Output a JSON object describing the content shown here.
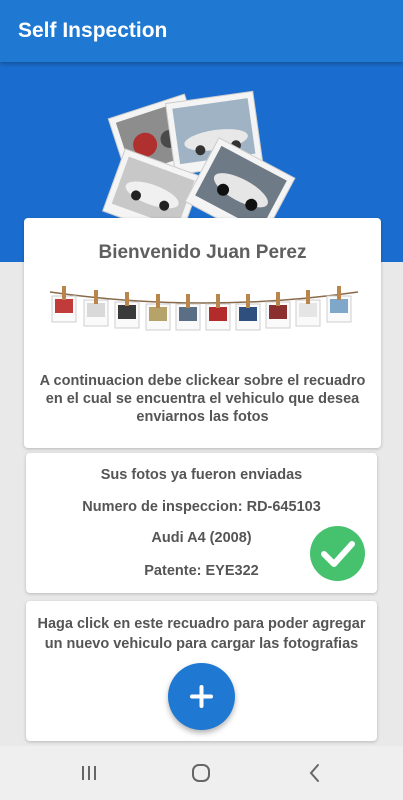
{
  "appbar": {
    "title": "Self Inspection"
  },
  "welcome": {
    "title": "Bienvenido Juan Perez",
    "instructions": "A continuacion debe clickear sobre el recuadro en el cual se encuentra el vehiculo que desea enviarnos las fotos"
  },
  "sent_card": {
    "status": "Sus fotos ya fueron enviadas",
    "inspection_number": "Numero de inspeccion: RD-645103",
    "vehicle": "Audi A4  (2008)",
    "plate": "Patente: EYE322",
    "status_color": "#46c26f"
  },
  "add_card": {
    "text": "Haga click en este recuadro para poder agregar un nuevo vehiculo para cargar las fotografias",
    "button_icon": "plus-icon"
  },
  "navbar": {
    "recents_icon": "recents-icon",
    "home_icon": "home-icon",
    "back_icon": "back-icon"
  },
  "colors": {
    "primary": "#1f78d1",
    "hero": "#1a6dce",
    "success": "#46c26f",
    "background": "#e9e9e9"
  }
}
